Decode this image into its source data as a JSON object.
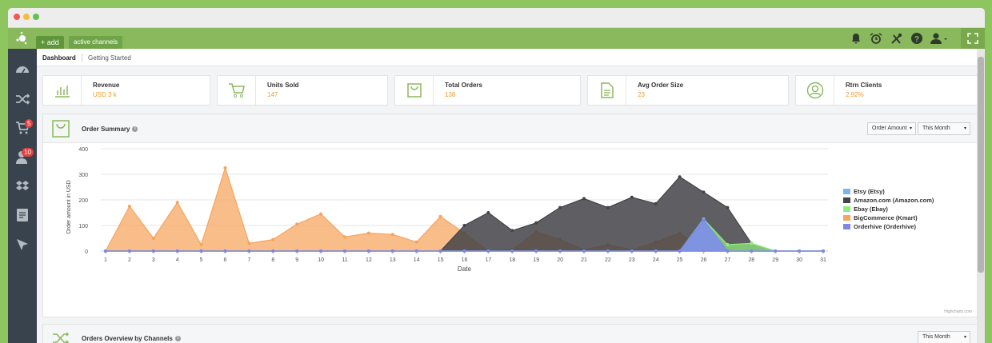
{
  "window": {
    "dots": [
      "#ee5a52",
      "#f5bd3a",
      "#5fc44c"
    ]
  },
  "topbar": {
    "add_label": "+ add",
    "channels_label": "active channels",
    "icons": [
      "bell-icon",
      "alarm-icon",
      "tools-icon",
      "help-icon",
      "user-icon",
      "expand-icon"
    ]
  },
  "sidebar": {
    "items": [
      {
        "icon": "dashboard-icon",
        "badge": ""
      },
      {
        "icon": "shuffle-icon",
        "badge": ""
      },
      {
        "icon": "cart-icon",
        "badge": "5"
      },
      {
        "icon": "user-icon",
        "badge": "10"
      },
      {
        "icon": "dropbox-icon",
        "badge": ""
      },
      {
        "icon": "invoice-icon",
        "badge": ""
      },
      {
        "icon": "send-icon",
        "badge": ""
      }
    ]
  },
  "tabs": {
    "dashboard": "Dashboard",
    "getting_started": "Getting Started"
  },
  "stats": [
    {
      "label": "Revenue",
      "value": "USD 3 k",
      "icon": "bar-chart-icon"
    },
    {
      "label": "Units Sold",
      "value": "147",
      "icon": "cart-icon"
    },
    {
      "label": "Total Orders",
      "value": "138",
      "icon": "bag-icon"
    },
    {
      "label": "Avg Order Size",
      "value": "23",
      "icon": "document-icon"
    },
    {
      "label": "Rtrn Clients",
      "value": "2.92%",
      "icon": "user-circle-icon"
    }
  ],
  "summary": {
    "title": "Order Summary",
    "filter1": "Order Amount",
    "filter2": "This Month",
    "credit": "Highcharts.com"
  },
  "overview": {
    "title": "Orders Overview by Channels",
    "filter": "This Month"
  },
  "chart_data": {
    "type": "area",
    "title": "",
    "xlabel": "Date",
    "ylabel": "Order amount in USD",
    "ylim": [
      0,
      400
    ],
    "yticks": [
      0,
      100,
      200,
      300,
      400
    ],
    "x": [
      1,
      2,
      3,
      4,
      5,
      6,
      7,
      8,
      9,
      10,
      11,
      12,
      13,
      14,
      15,
      16,
      17,
      18,
      19,
      20,
      21,
      22,
      23,
      24,
      25,
      26,
      27,
      28,
      29,
      30,
      31
    ],
    "legend_position": "right",
    "grid": true,
    "series": [
      {
        "name": "Etsy (Etsy)",
        "color": "#7cb5ec",
        "values": [
          0,
          0,
          0,
          0,
          0,
          0,
          0,
          0,
          0,
          0,
          0,
          0,
          0,
          0,
          0,
          0,
          0,
          0,
          0,
          0,
          0,
          0,
          0,
          0,
          0,
          125,
          0,
          0,
          0,
          0,
          0
        ]
      },
      {
        "name": "Amazon.com (Amazon.com)",
        "color": "#434348",
        "values": [
          0,
          0,
          0,
          0,
          0,
          0,
          0,
          0,
          0,
          0,
          0,
          0,
          0,
          0,
          0,
          100,
          150,
          80,
          110,
          170,
          205,
          170,
          210,
          185,
          290,
          230,
          170,
          30,
          0,
          0,
          0
        ]
      },
      {
        "name": "Ebay (Ebay)",
        "color": "#90ed7d",
        "values": [
          0,
          0,
          0,
          0,
          0,
          0,
          0,
          0,
          0,
          0,
          0,
          0,
          0,
          0,
          0,
          0,
          0,
          0,
          0,
          0,
          0,
          0,
          0,
          0,
          0,
          125,
          25,
          30,
          0,
          0,
          0
        ]
      },
      {
        "name": "BigCommerce (Kmart)",
        "color": "#f7a35c",
        "values": [
          0,
          175,
          50,
          190,
          25,
          325,
          30,
          45,
          105,
          145,
          55,
          70,
          65,
          35,
          135,
          70,
          0,
          5,
          75,
          45,
          5,
          25,
          5,
          35,
          70,
          0,
          0,
          0,
          0,
          0,
          0
        ]
      },
      {
        "name": "Orderhive (Orderhive)",
        "color": "#8085e9",
        "values": [
          0,
          0,
          0,
          0,
          0,
          0,
          0,
          0,
          0,
          0,
          0,
          0,
          0,
          0,
          0,
          0,
          0,
          0,
          0,
          0,
          0,
          0,
          0,
          0,
          0,
          120,
          0,
          0,
          0,
          0,
          0
        ]
      }
    ]
  }
}
